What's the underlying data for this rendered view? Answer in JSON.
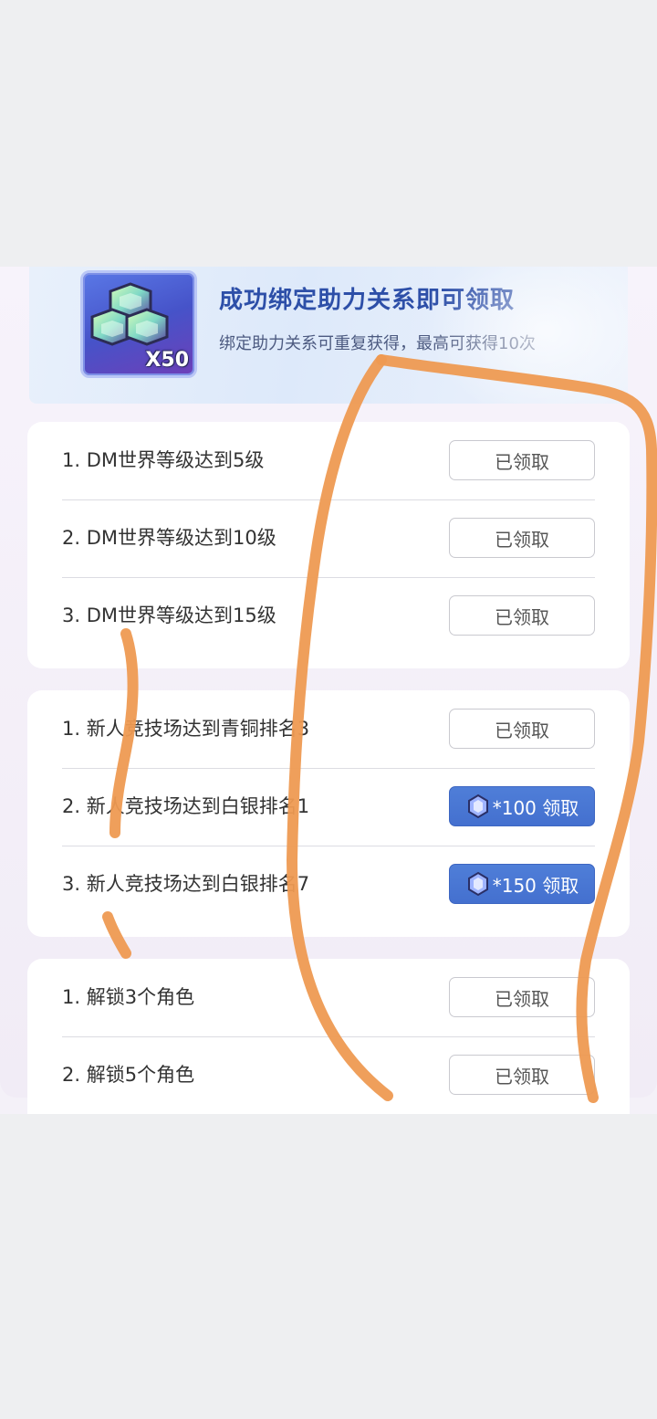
{
  "banner": {
    "title": "成功绑定助力关系即可领取",
    "subtitle": "绑定助力关系可重复获得，最高可获得10次",
    "reward_icon": "gem-cluster-icon",
    "reward_count": "X50"
  },
  "groups": [
    {
      "tasks": [
        {
          "label": "1. DM世界等级达到5级",
          "button": "已领取",
          "state": "claimed"
        },
        {
          "label": "2. DM世界等级达到10级",
          "button": "已领取",
          "state": "claimed"
        },
        {
          "label": "3. DM世界等级达到15级",
          "button": "已领取",
          "state": "claimed"
        }
      ]
    },
    {
      "tasks": [
        {
          "label": "1. 新人竞技场达到青铜排名3",
          "button": "已领取",
          "state": "claimed"
        },
        {
          "label": "2. 新人竞技场达到白银排名1",
          "button": "*100 领取",
          "state": "claimable",
          "icon": "gem-icon"
        },
        {
          "label": "3. 新人竞技场达到白银排名7",
          "button": "*150 领取",
          "state": "claimable",
          "icon": "gem-icon"
        }
      ]
    },
    {
      "tasks": [
        {
          "label": "1. 解锁3个角色",
          "button": "已领取",
          "state": "claimed"
        },
        {
          "label": "2. 解锁5个角色",
          "button": "已领取",
          "state": "claimed"
        }
      ]
    }
  ],
  "colors": {
    "title": "#2d4fa8",
    "claim_button": "#4470cf",
    "annotation_stroke": "#ee9a52"
  }
}
